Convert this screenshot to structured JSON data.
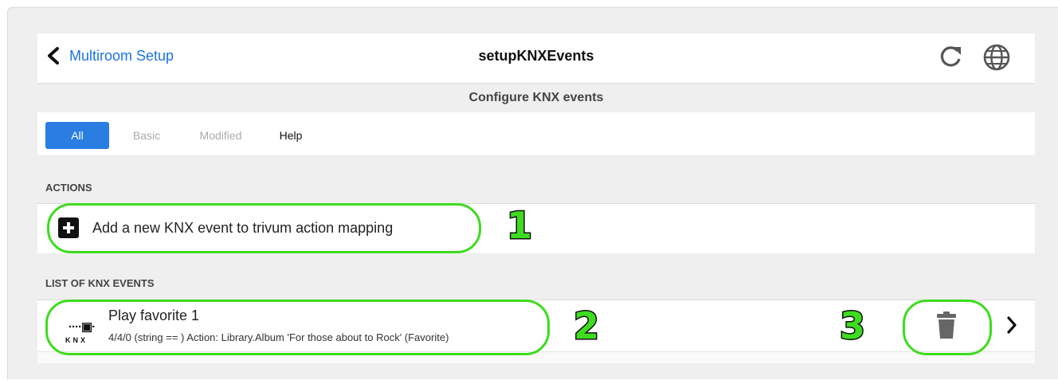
{
  "header": {
    "back_label": "Multiroom Setup",
    "title": "setupKNXEvents",
    "icons": [
      "chevron-left-icon",
      "refresh-icon",
      "globe-icon"
    ]
  },
  "subheader": "Configure KNX events",
  "tabs": [
    {
      "label": "All",
      "selected": true
    },
    {
      "label": "Basic",
      "selected": false
    },
    {
      "label": "Modified",
      "selected": false
    },
    {
      "label": "Help",
      "selected": false
    }
  ],
  "actions": {
    "section_label": "ACTIONS",
    "add_label": "Add a new KNX event to trivum action mapping"
  },
  "events": {
    "section_label": "LIST OF KNX EVENTS",
    "items": [
      {
        "logo_text": "KNX",
        "title": "Play favorite 1",
        "subtitle": "4/4/0 (string == ) Action: Library.Album 'For those about to Rock' (Favorite)"
      }
    ]
  },
  "callouts": [
    "1",
    "2",
    "3"
  ],
  "colors": {
    "accent": "#2a7de1",
    "link": "#1a73e8",
    "highlight": "#3ddc1f"
  }
}
